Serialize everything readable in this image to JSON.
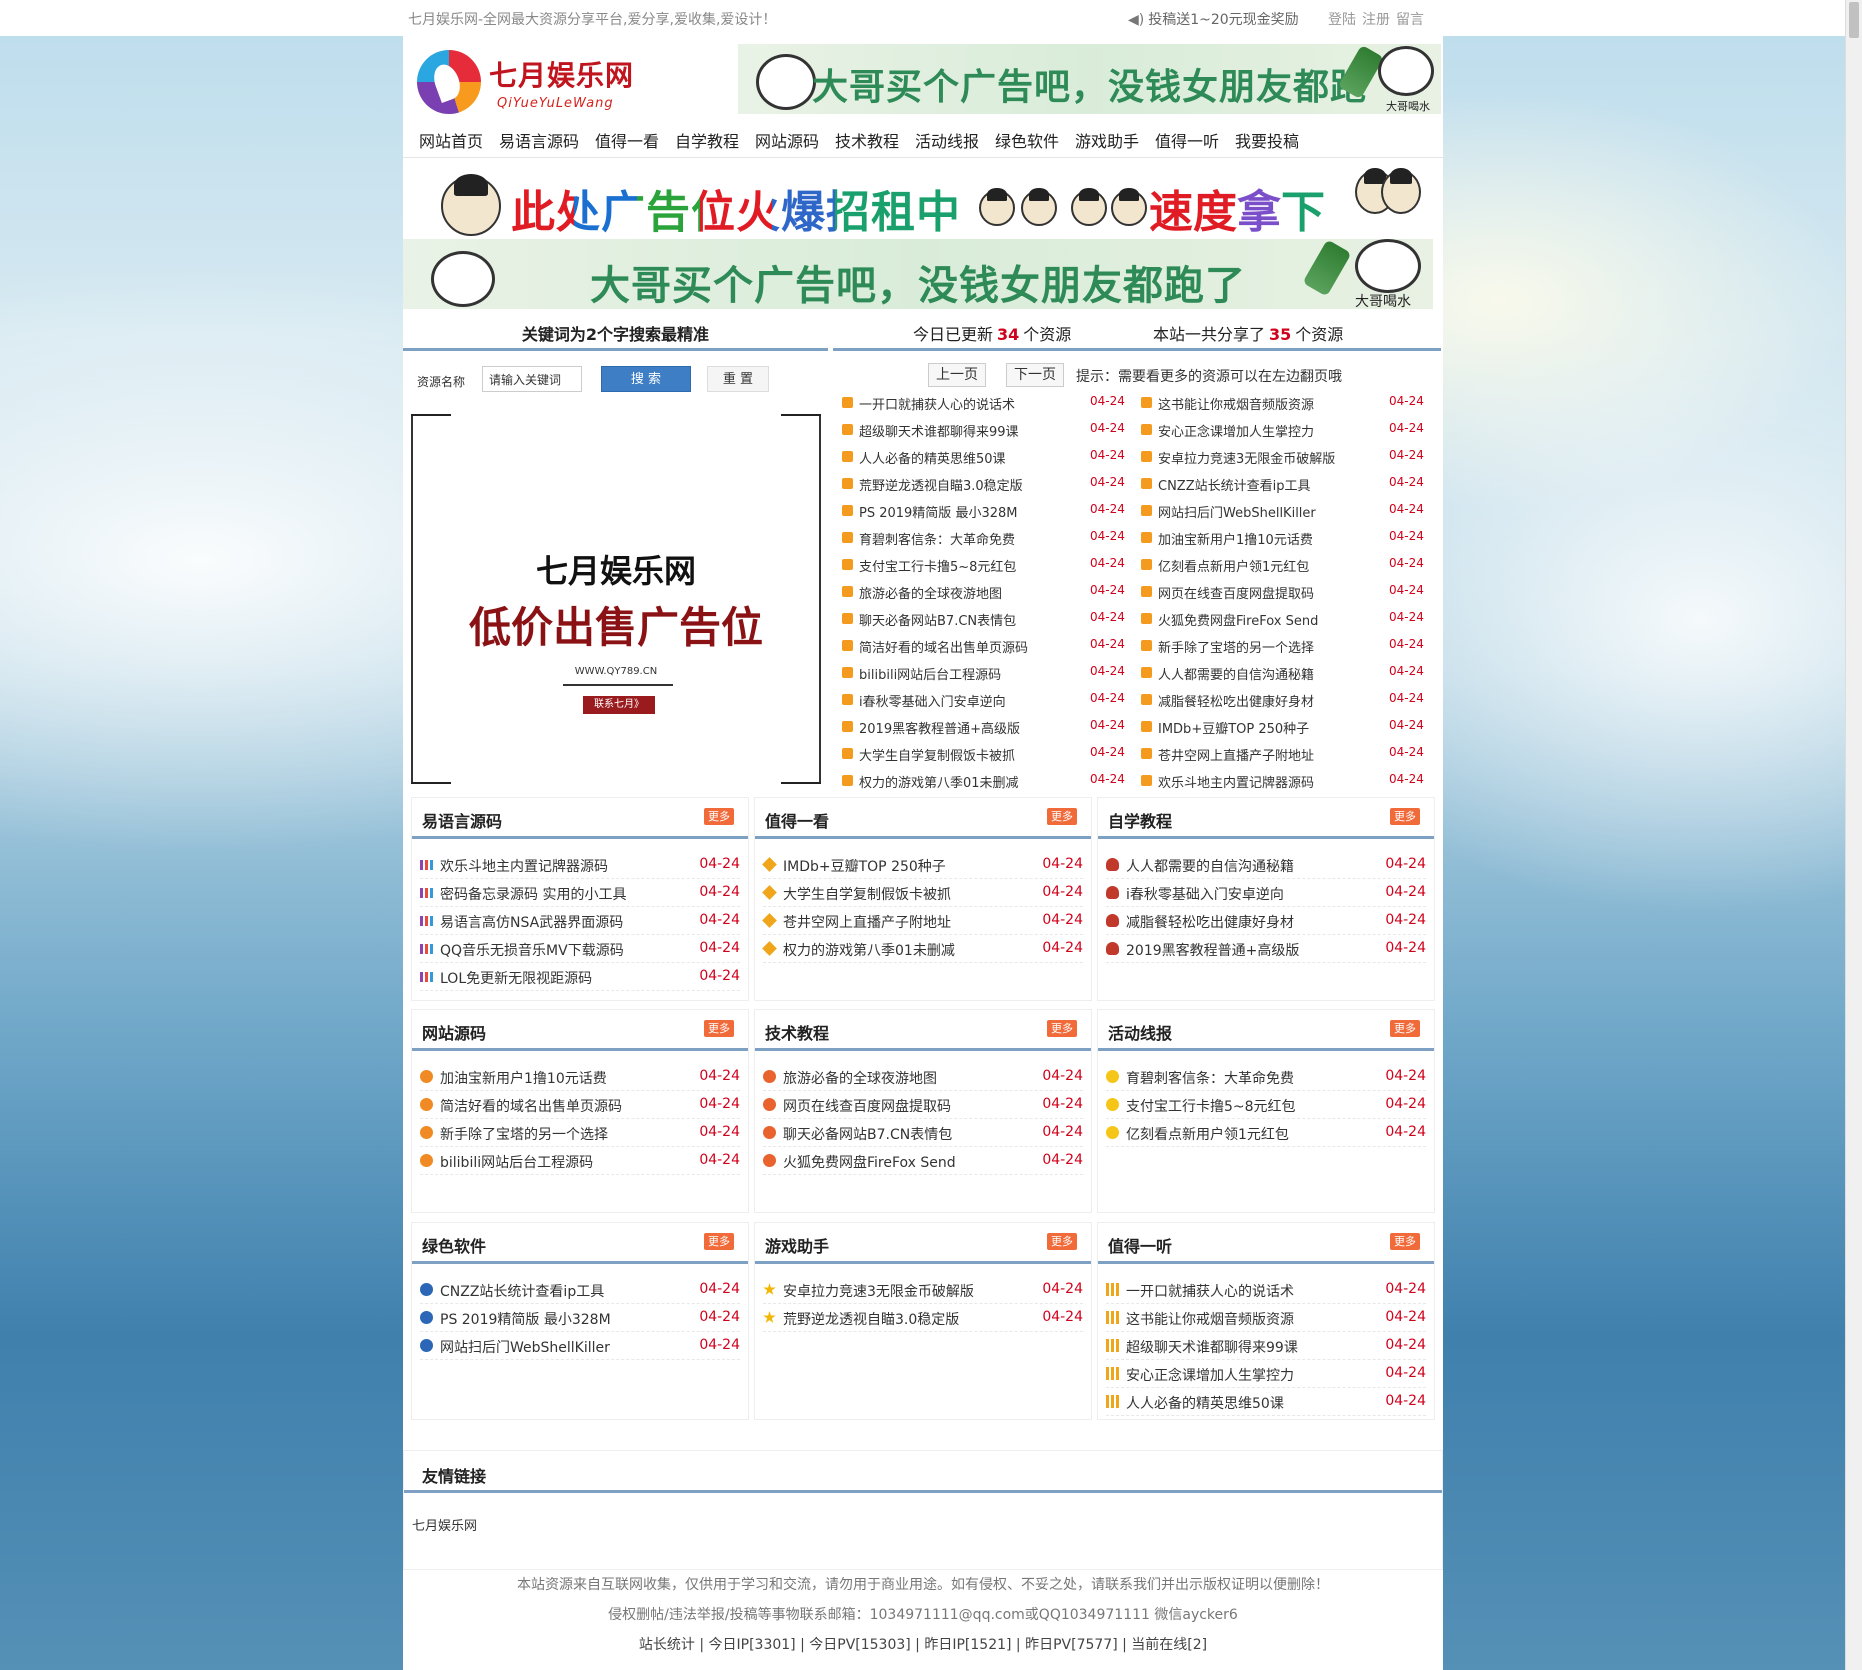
{
  "top": {
    "slogan": "七月娱乐网-全网最大资源分享平台,爱分享,爱收集,爱设计！",
    "reward": "投稿送1~20元现金奖励",
    "login": "登陆",
    "register": "注册",
    "message": "留言"
  },
  "logo": {
    "name": "七月娱乐网",
    "pinyin": "QiYueYuLeWang"
  },
  "ad_banner": {
    "text": "大哥买个广告吧，没钱女朋友都跑了",
    "caption": "大哥喝水"
  },
  "nav": [
    "网站首页",
    "易语言源码",
    "值得一看",
    "自学教程",
    "网站源码",
    "技术教程",
    "活动线报",
    "绿色软件",
    "游戏助手",
    "值得一听",
    "我要投稿"
  ],
  "rent_ad": {
    "part1": "此处广告位火爆招租中",
    "part2": "速度拿下"
  },
  "search": {
    "heading": "关键词为2个字搜索最精准",
    "label": "资源名称",
    "placeholder": "请输入关键词",
    "button": "搜 索",
    "reset": "重 置"
  },
  "side_ad": {
    "line1": "七月娱乐网",
    "line2": "低价出售广告位",
    "url": "WWW.QY789.CN",
    "contact": "联系七月》"
  },
  "updates": {
    "today_prefix": "今日已更新",
    "today_count": "34",
    "today_suffix": "个资源",
    "total_prefix": "本站一共分享了",
    "total_count": "35",
    "total_suffix": "个资源",
    "prev": "上一页",
    "next": "下一页",
    "tip": "提示：需要看更多的资源可以在左边翻页哦",
    "left": [
      [
        "一开口就捕获人心的说话术",
        "04-24"
      ],
      [
        "超级聊天术谁都聊得来99课",
        "04-24"
      ],
      [
        "人人必备的精英思维50课",
        "04-24"
      ],
      [
        "荒野逆龙透视自瞄3.0稳定版",
        "04-24"
      ],
      [
        "PS 2019精简版 最小328M",
        "04-24"
      ],
      [
        "育碧刺客信条：大革命免费",
        "04-24"
      ],
      [
        "支付宝工行卡撸5~8元红包",
        "04-24"
      ],
      [
        "旅游必备的全球夜游地图",
        "04-24"
      ],
      [
        "聊天必备网站B7.CN表情包",
        "04-24"
      ],
      [
        "简洁好看的域名出售单页源码",
        "04-24"
      ],
      [
        "bilibili网站后台工程源码",
        "04-24"
      ],
      [
        "i春秋零基础入门安卓逆向",
        "04-24"
      ],
      [
        "2019黑客教程普通+高级版",
        "04-24"
      ],
      [
        "大学生自学复制假饭卡被抓",
        "04-24"
      ],
      [
        "权力的游戏第八季01未删减",
        "04-24"
      ]
    ],
    "right": [
      [
        "这书能让你戒烟音频版资源",
        "04-24"
      ],
      [
        "安心正念课增加人生掌控力",
        "04-24"
      ],
      [
        "安卓拉力竞速3无限金币破解版",
        "04-24"
      ],
      [
        "CNZZ站长统计查看ip工具",
        "04-24"
      ],
      [
        "网站扫后门WebShellKiller",
        "04-24"
      ],
      [
        "加油宝新用户1撸10元话费",
        "04-24"
      ],
      [
        "亿刻看点新用户领1元红包",
        "04-24"
      ],
      [
        "网页在线查百度网盘提取码",
        "04-24"
      ],
      [
        "火狐免费网盘FireFox Send",
        "04-24"
      ],
      [
        "新手除了宝塔的另一个选择",
        "04-24"
      ],
      [
        "人人都需要的自信沟通秘籍",
        "04-24"
      ],
      [
        "减脂餐轻松吃出健康好身材",
        "04-24"
      ],
      [
        "IMDb+豆瓣TOP 250种子",
        "04-24"
      ],
      [
        "苍井空网上直播产子附地址",
        "04-24"
      ],
      [
        "欢乐斗地主内置记牌器源码",
        "04-24"
      ]
    ]
  },
  "more": "更多",
  "panels": [
    {
      "title": "易语言源码",
      "icon": "bar",
      "items": [
        [
          "欢乐斗地主内置记牌器源码",
          "04-24"
        ],
        [
          "密码备忘录源码 实用的小工具",
          "04-24"
        ],
        [
          "易语言高仿NSA武器界面源码",
          "04-24"
        ],
        [
          "QQ音乐无损音乐MV下载源码",
          "04-24"
        ],
        [
          "LOL免更新无限视距源码",
          "04-24"
        ]
      ]
    },
    {
      "title": "值得一看",
      "icon": "gem",
      "items": [
        [
          "IMDb+豆瓣TOP 250种子",
          "04-24"
        ],
        [
          "大学生自学复制假饭卡被抓",
          "04-24"
        ],
        [
          "苍井空网上直播产子附地址",
          "04-24"
        ],
        [
          "权力的游戏第八季01未删减",
          "04-24"
        ]
      ]
    },
    {
      "title": "自学教程",
      "icon": "qq",
      "items": [
        [
          "人人都需要的自信沟通秘籍",
          "04-24"
        ],
        [
          "i春秋零基础入门安卓逆向",
          "04-24"
        ],
        [
          "减脂餐轻松吃出健康好身材",
          "04-24"
        ],
        [
          "2019黑客教程普通+高级版",
          "04-24"
        ]
      ]
    },
    {
      "title": "网站源码",
      "icon": "coin",
      "items": [
        [
          "加油宝新用户1撸10元话费",
          "04-24"
        ],
        [
          "简洁好看的域名出售单页源码",
          "04-24"
        ],
        [
          "新手除了宝塔的另一个选择",
          "04-24"
        ],
        [
          "bilibili网站后台工程源码",
          "04-24"
        ]
      ]
    },
    {
      "title": "技术教程",
      "icon": "back",
      "items": [
        [
          "旅游必备的全球夜游地图",
          "04-24"
        ],
        [
          "网页在线查百度网盘提取码",
          "04-24"
        ],
        [
          "聊天必备网站B7.CN表情包",
          "04-24"
        ],
        [
          "火狐免费网盘FireFox Send",
          "04-24"
        ]
      ]
    },
    {
      "title": "活动线报",
      "icon": "sun",
      "items": [
        [
          "育碧刺客信条：大革命免费",
          "04-24"
        ],
        [
          "支付宝工行卡撸5~8元红包",
          "04-24"
        ],
        [
          "亿刻看点新用户领1元红包",
          "04-24"
        ]
      ]
    },
    {
      "title": "绿色软件",
      "icon": "ball",
      "items": [
        [
          "CNZZ站长统计查看ip工具",
          "04-24"
        ],
        [
          "PS 2019精简版 最小328M",
          "04-24"
        ],
        [
          "网站扫后门WebShellKiller",
          "04-24"
        ]
      ]
    },
    {
      "title": "游戏助手",
      "icon": "star",
      "items": [
        [
          "安卓拉力竞速3无限金币破解版",
          "04-24"
        ],
        [
          "荒野逆龙透视自瞄3.0稳定版",
          "04-24"
        ]
      ]
    },
    {
      "title": "值得一听",
      "icon": "music",
      "items": [
        [
          "一开口就捕获人心的说话术",
          "04-24"
        ],
        [
          "这书能让你戒烟音频版资源",
          "04-24"
        ],
        [
          "超级聊天术谁都聊得来99课",
          "04-24"
        ],
        [
          "安心正念课增加人生掌控力",
          "04-24"
        ],
        [
          "人人必备的精英思维50课",
          "04-24"
        ]
      ]
    }
  ],
  "links": {
    "title": "友情链接",
    "items": [
      "七月娱乐网"
    ]
  },
  "footer": {
    "line1": "本站资源来自互联网收集，仅供用于学习和交流，请勿用于商业用途。如有侵权、不妥之处，请联系我们并出示版权证明以便删除！",
    "line2": "侵权删帖/违法举报/投稿等事物联系邮箱：1034971111@qq.com或QQ1034971111 微信aycker6",
    "line3": "站长统计 | 今日IP[3301] | 今日PV[15303] | 昨日IP[1521] | 昨日PV[7577] | 当前在线[2]"
  }
}
